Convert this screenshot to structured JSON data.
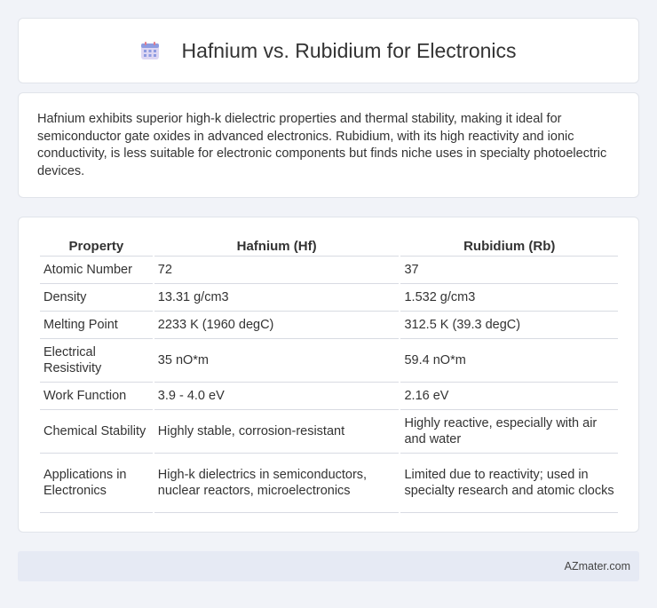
{
  "header": {
    "title": "Hafnium vs. Rubidium for Electronics",
    "icon": "calendar-icon"
  },
  "intro": {
    "text": "Hafnium exhibits superior high-k dielectric properties and thermal stability, making it ideal for semiconductor gate oxides in advanced electronics. Rubidium, with its high reactivity and ionic conductivity, is less suitable for electronic components but finds niche uses in specialty photoelectric devices."
  },
  "table": {
    "headers": [
      "Property",
      "Hafnium (Hf)",
      "Rubidium (Rb)"
    ],
    "rows": [
      [
        "Atomic Number",
        "72",
        "37"
      ],
      [
        "Density",
        "13.31 g/cm3",
        "1.532 g/cm3"
      ],
      [
        "Melting Point",
        "2233 K (1960 degC)",
        "312.5 K (39.3 degC)"
      ],
      [
        "Electrical Resistivity",
        "35 nO*m",
        "59.4 nO*m"
      ],
      [
        "Work Function",
        "3.9 - 4.0 eV",
        "2.16 eV"
      ],
      [
        "Chemical Stability",
        "Highly stable, corrosion-resistant",
        "Highly reactive, especially with air and water"
      ],
      [
        "Applications in Electronics",
        "High-k dielectrics in semiconductors, nuclear reactors, microelectronics",
        "Limited due to reactivity; used in specialty research and atomic clocks"
      ]
    ]
  },
  "footer": {
    "brand": "AZmater.com"
  }
}
